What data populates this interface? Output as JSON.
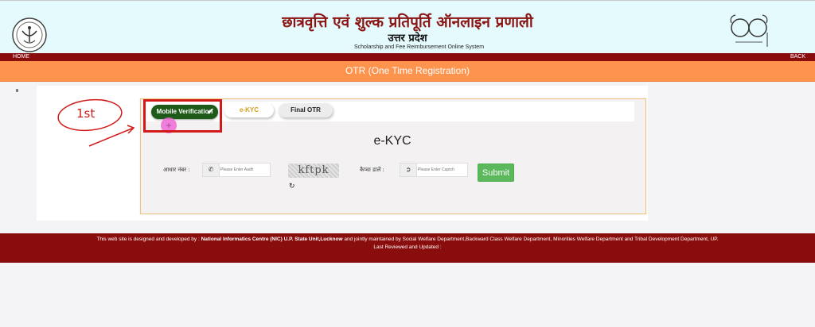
{
  "header": {
    "title_hindi": "छात्रवृत्ति एवं शुल्क प्रतिपूर्ति ऑनलाइन प्रणाली",
    "state_hindi": "उत्तर प्रदेश",
    "subtitle_english": "Scholarship and Fee Reimbursement Online System"
  },
  "nav": {
    "home": "HOME",
    "back": "BACK"
  },
  "page_bar": {
    "title": "OTR (One Time Registration)"
  },
  "steps": [
    {
      "label": "Mobile Verification",
      "completed": true
    },
    {
      "label": "e-KYC",
      "completed": false
    },
    {
      "label": "Final OTR",
      "completed": false
    }
  ],
  "annotation": {
    "step_label": "1st"
  },
  "form": {
    "heading": "e-KYC",
    "aadhar_label": "आधार नंबर :",
    "aadhar_placeholder": "Please Enter Aadh",
    "captcha_text": "kftpk",
    "captcha_label": "कैप्चा डालें :",
    "captcha_placeholder": "Please Enter Captch",
    "submit_label": "Submit"
  },
  "footer": {
    "prefix": "This web site is designed and developed by :",
    "developer": "National Informatics Centre (NIC) U.P. State Unit,Lucknow",
    "maintained_by": "and jointly maintained by Social Welfare Department,Backward Class Welfare Department, Minorities Welfare Department and Tribal Development Department, UP.",
    "last_reviewed": "Last Reviewed and Updated :"
  },
  "colors": {
    "header_bg": "#e4fafd",
    "title_maroon": "#8b1513",
    "navbar_maroon": "#8a0d0d",
    "otr_orange": "#fd934d",
    "step_done_green": "#1e5a18",
    "submit_green": "#5cb85c",
    "annotation_red": "#d21a1a"
  },
  "icons": {
    "left_logo": "up-government-emblem",
    "right_logo": "swachh-bharat-logo",
    "phone": "phone-icon",
    "captcha_field": "circle-arrow-icon",
    "refresh": "refresh-icon",
    "checkmark": "check-icon"
  }
}
